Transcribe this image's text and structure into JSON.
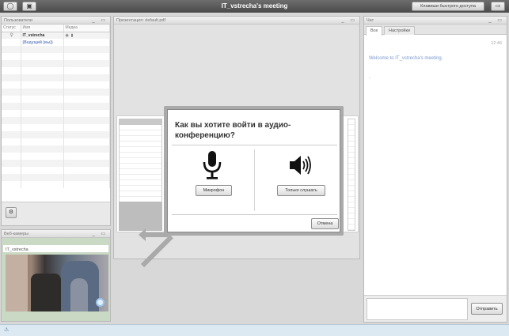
{
  "topbar": {
    "title": "IT_vstrecha's meeting",
    "shortcut_label": "Клавиши быстрого доступа",
    "left_icons": [
      "headset-icon",
      "presenter-icon"
    ],
    "right_icon": "logout-icon"
  },
  "users": {
    "title": "Пользователи",
    "columns": [
      "Статус",
      "Имя",
      "Медиа"
    ],
    "rows": [
      {
        "name": "IT_vstrecha",
        "sub": "(Ведущий (вы))"
      }
    ],
    "controls": "_ ▭"
  },
  "webcams": {
    "title": "Веб-камеры",
    "stream_label": "IT_vstrecha",
    "controls": "_ ▭"
  },
  "presentation": {
    "title": "Презентация: default.pdf",
    "controls": "_ ▭"
  },
  "modal": {
    "title": "Как вы хотите войти в аудио-конференцию?",
    "mic_button": "Микрофон",
    "listen_button": "Только слушать",
    "cancel_button": "Отмена"
  },
  "chat": {
    "title": "Чат",
    "controls": "_ ▭",
    "tabs": [
      "Все",
      "Настройки"
    ],
    "time": "12:46",
    "welcome": "Welcome to IT_vstrecha's meeting.",
    "dash": "-",
    "send_button": "Отправить"
  },
  "status": {
    "icon": "warning-icon",
    "warn": "⚠"
  }
}
